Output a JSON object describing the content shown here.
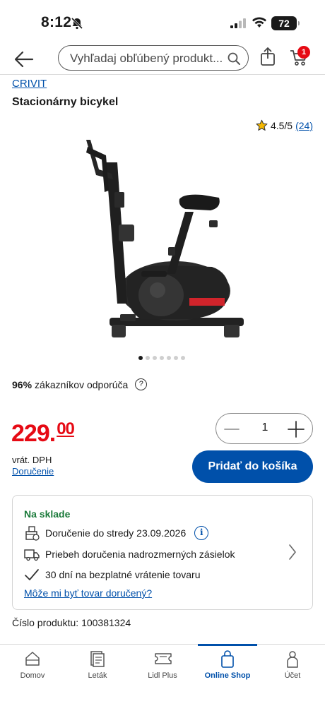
{
  "status": {
    "time": "8:12",
    "battery": "72"
  },
  "search": {
    "placeholder": "Vyhľadaj obľúbený produkt..."
  },
  "cart": {
    "badge_count": "1"
  },
  "product": {
    "brand": "CRIVIT",
    "title": "Stacionárny bicykel",
    "rating": "4.5/5",
    "rating_count": "(24)",
    "image_count": 7,
    "active_image": 1,
    "recommend_percent": "96%",
    "recommend_text": "zákazníkov odporúča",
    "price_main": "229.",
    "price_cents": "00",
    "vat_note": "vrát. DPH",
    "delivery_link": "Doručenie",
    "quantity": "1",
    "add_to_cart_label": "Pridať do košíka",
    "product_number_label": "Číslo produktu:",
    "product_number": "100381324"
  },
  "availability": {
    "status": "Na sklade",
    "delivery_date": "Doručenie do stredy 23.09.2026",
    "oversize_delivery": "Priebeh doručenia nadrozmerných zásielok",
    "returns": "30 dní na bezplatné vrátenie tovaru",
    "can_deliver_link": "Môže mi byť tovar doručený?"
  },
  "tabs": [
    {
      "label": "Domov",
      "icon": "home-icon"
    },
    {
      "label": "Leták",
      "icon": "leaflet-icon"
    },
    {
      "label": "Lidl Plus",
      "icon": "ticket-icon"
    },
    {
      "label": "Online Shop",
      "icon": "shopping-bag-icon",
      "active": true
    },
    {
      "label": "Účet",
      "icon": "account-icon"
    }
  ],
  "colors": {
    "brand_blue": "#0050aa",
    "price_red": "#e60a14",
    "stock_green": "#1a7a3a"
  }
}
